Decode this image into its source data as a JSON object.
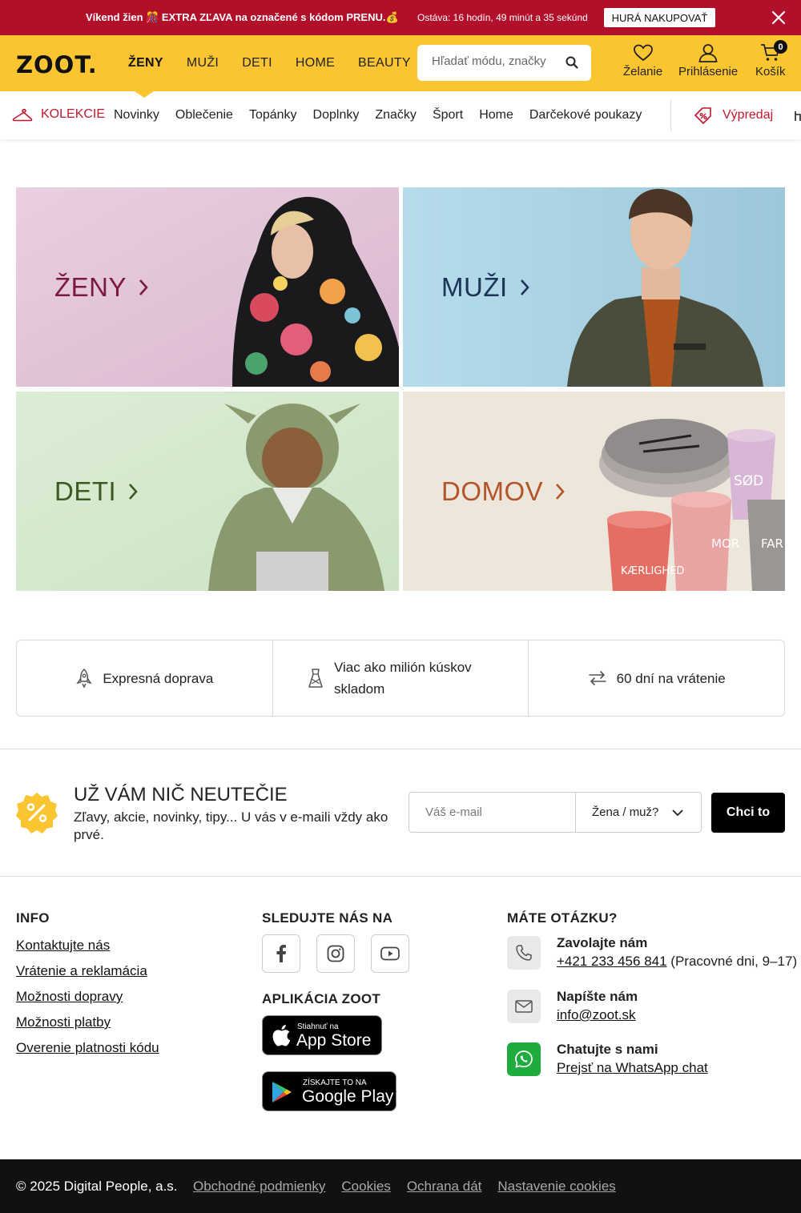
{
  "promo": {
    "message": "Víkend žien 🎊 EXTRA ZĽAVA na označené s kódom PRENU.💰",
    "countdown": "Ostáva: 16 hodín, 49 minút a 35 sekúnd",
    "cta": "HURÁ NAKUPOVAŤ",
    "background": "#b2102a"
  },
  "header": {
    "logo": "ZOOT.",
    "background": "#fbc531",
    "nav": [
      "ŽENY",
      "MUŽI",
      "DETI",
      "HOME",
      "BEAUTY"
    ],
    "active_nav": "ŽENY",
    "search_placeholder": "Hľadať módu, značky",
    "wishlist": "Želanie",
    "login": "Prihlásenie",
    "cart": "Košík",
    "cart_count": "0"
  },
  "subnav": {
    "collections": "KOLEKCIE",
    "links": [
      "Novinky",
      "Oblečenie",
      "Topánky",
      "Doplnky",
      "Značky",
      "Šport",
      "Home",
      "Darčekové poukazy"
    ],
    "sale": "Výpredaj",
    "accent": "#c0192e"
  },
  "categories": [
    {
      "label": "ŽENY",
      "color": "#7a1b3e",
      "background": "#eccfdf"
    },
    {
      "label": "MUŽI",
      "color": "#1c3356",
      "background": "#aed3e3"
    },
    {
      "label": "DETI",
      "color": "#3a5a1f",
      "background": "#d8ead2"
    },
    {
      "label": "DOMOV",
      "color": "#b4542a",
      "background": "#ece6db"
    }
  ],
  "mug_labels": [
    "SØD",
    "MOR",
    "KÆRLIGHED",
    "FAR"
  ],
  "benefits": [
    "Expresná doprava",
    "Viac ako milión kúskov skladom",
    "60 dní na vrátenie"
  ],
  "newsletter": {
    "title": "UŽ VÁM NIČ NEUTEČIE",
    "subtitle": "Zľavy, akcie, novinky, tipy... U vás v e-maili vždy ako prvé.",
    "email_placeholder": "Váš e-mail",
    "gender_select": "Žena / muž?",
    "button": "Chci to"
  },
  "footer": {
    "info_title": "INFO",
    "info_links": [
      "Kontaktujte nás",
      "Vrátenie a reklamácia",
      "Možnosti dopravy",
      "Možnosti platby",
      "Overenie platnosti kódu"
    ],
    "follow_title": "SLEDUJTE NÁS NA",
    "social": [
      "facebook-icon",
      "instagram-icon",
      "youtube-icon"
    ],
    "app_title": "APLIKÁCIA ZOOT",
    "app_store_small": "Stiahnuť na",
    "app_store_big": "App Store",
    "google_play_small": "ZÍSKAJTE TO NA",
    "google_play_big": "Google Play",
    "questions_title": "MÁTE OTÁZKU?",
    "call_title": "Zavolajte nám",
    "phone": "+421 233 456 841",
    "phone_hours": "(Pracovné dni, 9–17)",
    "write_title": "Napíšte nám",
    "email": "info@zoot.sk",
    "chat_title": "Chatujte s nami",
    "chat_link": "Prejsť na WhatsApp chat"
  },
  "bottom": {
    "copyright": "© 2025 Digital People, a.s.",
    "links": [
      "Obchodné podmienky",
      "Cookies",
      "Ochrana dát",
      "Nastavenie cookies"
    ]
  }
}
